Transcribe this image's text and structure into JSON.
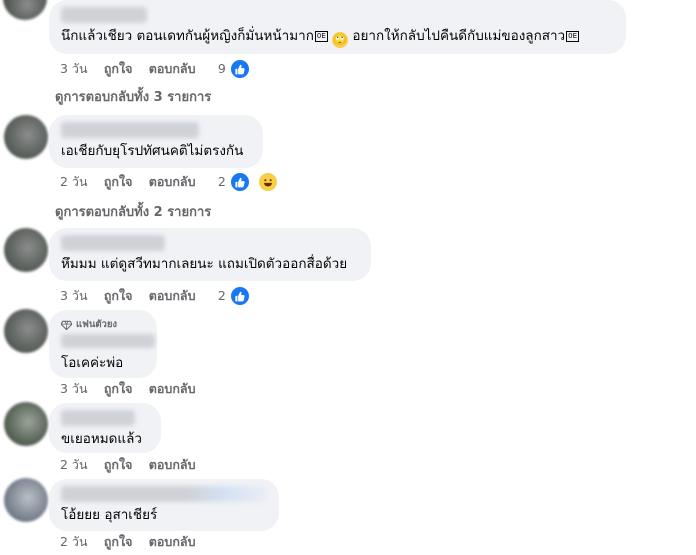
{
  "comments": [
    {
      "text": "นึกแล้วเชียว ตอนเดทกันผู้หญิงก็มั่นหน้ามาก",
      "glyph1": "0E",
      "emoji": "🙄",
      "text2": "อยากให้กลับไปคืนดีกับแม่ของลูกสาว",
      "glyph2": "0E",
      "time": "3 วัน",
      "like": "ถูกใจ",
      "reply": "ตอบกลับ",
      "reaction_count": "9",
      "view_replies": "ดูการตอบกลับทั้ง 3 รายการ"
    },
    {
      "text": "เอเชียกับยุโรปทัศนคติไม่ตรงกัน",
      "time": "2 วัน",
      "like": "ถูกใจ",
      "reply": "ตอบกลับ",
      "reaction_count": "2",
      "view_replies": "ดูการตอบกลับทั้ง 2 รายการ"
    },
    {
      "text": "หึมมม แต่ดูสวีทมากเลยนะ แถมเปิดตัวออกสื่อด้วย",
      "time": "3 วัน",
      "like": "ถูกใจ",
      "reply": "ตอบกลับ",
      "reaction_count": "2"
    },
    {
      "badge": "แฟนตัวยง",
      "text": "โอเคค่ะพ่อ",
      "time": "3 วัน",
      "like": "ถูกใจ",
      "reply": "ตอบกลับ"
    },
    {
      "text": "ขเยอหมดแล้ว",
      "time": "2 วัน",
      "like": "ถูกใจ",
      "reply": "ตอบกลับ"
    },
    {
      "text": "โอ้ยยย อุสาเชียร์",
      "time": "2 วัน",
      "like": "ถูกใจ",
      "reply": "ตอบกลับ"
    }
  ],
  "colors": {
    "bubble": "#f0f2f5",
    "meta_text": "#65676b",
    "like_blue": "#1877f2"
  },
  "icons": {
    "like": "thumbs-up-icon",
    "haha": "laughing-emoji-icon",
    "badge": "diamond-icon"
  }
}
